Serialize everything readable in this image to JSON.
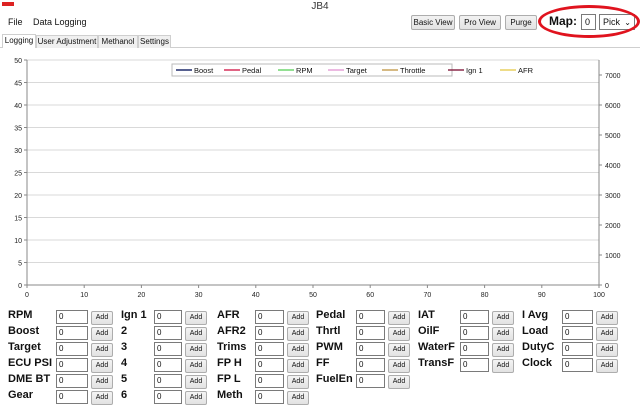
{
  "window": {
    "title": "JB4"
  },
  "menu": [
    {
      "label": "File"
    },
    {
      "label": "Data Logging"
    }
  ],
  "toolbar": {
    "basic_view": "Basic View",
    "pro_view": "Pro View",
    "purge": "Purge"
  },
  "map": {
    "label": "Map:",
    "value": "0",
    "selected": "Pick"
  },
  "tabs": [
    {
      "label": "Logging",
      "active": true
    },
    {
      "label": "User Adjustment",
      "active": false
    },
    {
      "label": "Methanol",
      "active": false
    },
    {
      "label": "Settings",
      "active": false
    }
  ],
  "chart_data": {
    "type": "line",
    "x_ticks": [
      "0",
      "10",
      "20",
      "30",
      "40",
      "50",
      "60",
      "70",
      "80",
      "90",
      "100"
    ],
    "y_left_ticks": [
      "0",
      "5",
      "10",
      "15",
      "20",
      "25",
      "30",
      "35",
      "40",
      "45",
      "50"
    ],
    "y_right_ticks": [
      "0",
      "1000",
      "2000",
      "3000",
      "4000",
      "5000",
      "6000",
      "7000"
    ],
    "xlim": [
      0,
      100
    ],
    "ylim_left": [
      0,
      50
    ],
    "ylim_right": [
      0,
      7500
    ],
    "grid": true,
    "legend_placement": "top-center",
    "series": [
      {
        "name": "Boost",
        "color": "#1f2a6b",
        "values": []
      },
      {
        "name": "Pedal",
        "color": "#d6315a",
        "values": []
      },
      {
        "name": "RPM",
        "color": "#6fd66f",
        "values": []
      },
      {
        "name": "Target",
        "color": "#e6a2d8",
        "values": []
      },
      {
        "name": "Throttle",
        "color": "#c9a35a",
        "values": []
      },
      {
        "name": "Ign 1",
        "color": "#8a2a4a",
        "values": []
      },
      {
        "name": "AFR",
        "color": "#e8d060",
        "values": []
      }
    ]
  },
  "add_label": "Add",
  "gauges": [
    [
      {
        "label": "RPM",
        "value": "0"
      },
      {
        "label": "Boost",
        "value": "0"
      },
      {
        "label": "Target",
        "value": "0"
      },
      {
        "label": "ECU PSI",
        "value": "0"
      },
      {
        "label": "DME BT",
        "value": "0"
      },
      {
        "label": "Gear",
        "value": "0"
      }
    ],
    [
      {
        "label": "Ign 1",
        "value": "0"
      },
      {
        "label": "2",
        "value": "0"
      },
      {
        "label": "3",
        "value": "0"
      },
      {
        "label": "4",
        "value": "0"
      },
      {
        "label": "5",
        "value": "0"
      },
      {
        "label": "6",
        "value": "0"
      }
    ],
    [
      {
        "label": "AFR",
        "value": "0"
      },
      {
        "label": "AFR2",
        "value": "0"
      },
      {
        "label": "Trims",
        "value": "0"
      },
      {
        "label": "FP H",
        "value": "0"
      },
      {
        "label": "FP L",
        "value": "0"
      },
      {
        "label": "Meth",
        "value": "0"
      }
    ],
    [
      {
        "label": "Pedal",
        "value": "0"
      },
      {
        "label": "Thrtl",
        "value": "0"
      },
      {
        "label": "PWM",
        "value": "0"
      },
      {
        "label": "FF",
        "value": "0"
      },
      {
        "label": "FuelEn",
        "value": "0"
      }
    ],
    [
      {
        "label": "IAT",
        "value": "0"
      },
      {
        "label": "OilF",
        "value": "0"
      },
      {
        "label": "WaterF",
        "value": "0"
      },
      {
        "label": "TransF",
        "value": "0"
      }
    ],
    [
      {
        "label": "I Avg",
        "value": "0"
      },
      {
        "label": "Load",
        "value": "0"
      },
      {
        "label": "DutyC",
        "value": "0"
      },
      {
        "label": "Clock",
        "value": "0"
      }
    ]
  ]
}
